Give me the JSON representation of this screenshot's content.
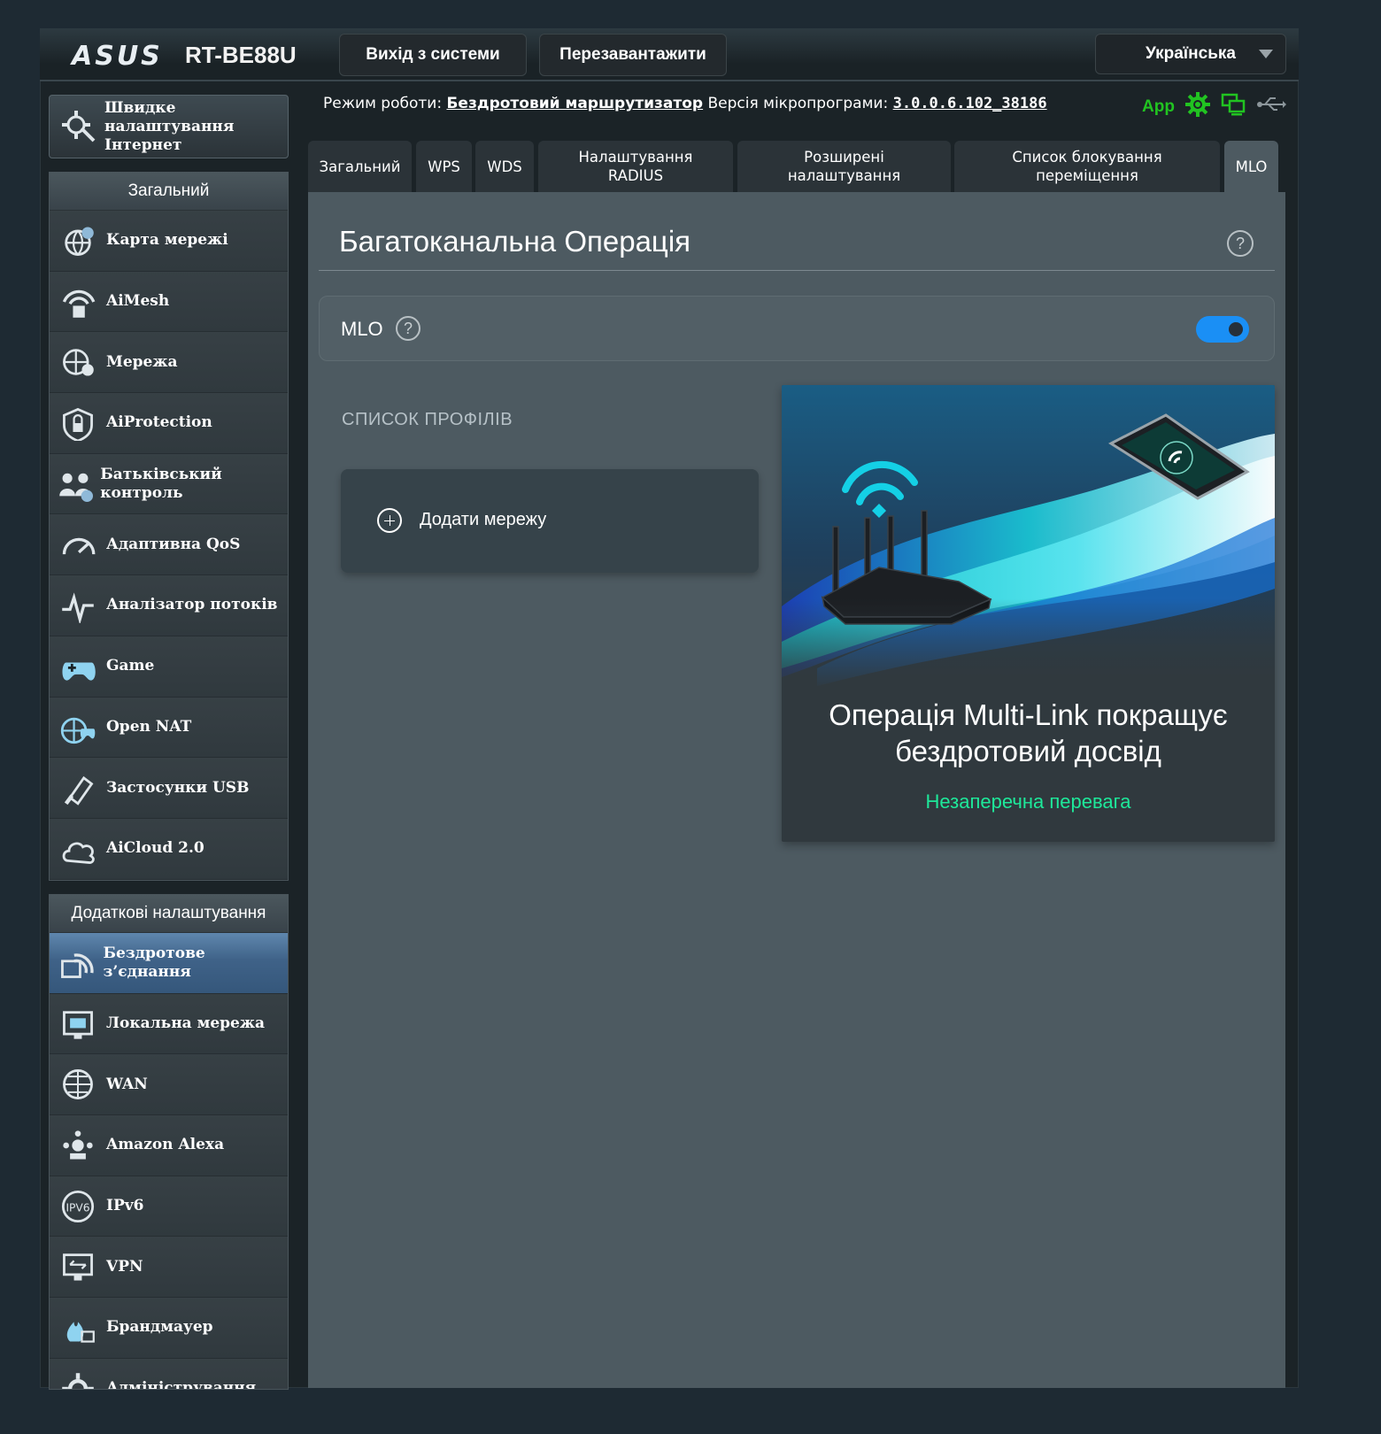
{
  "header": {
    "brand": "ASUS",
    "model": "RT-BE88U",
    "logout_label": "Вихід з системи",
    "reboot_label": "Перезавантажити",
    "language": "Українська"
  },
  "status": {
    "mode_label": "Режим роботи:",
    "mode_value": "Бездротовий маршрутизатор",
    "firmware_label": "Версія мікропрограми:",
    "firmware_value": "3.0.0.6.102_38186",
    "app_label": "App",
    "colors": {
      "app": "#21c321"
    }
  },
  "sidebar": {
    "quick_setup": "Швидке налаштування Інтернет",
    "general_header": "Загальний",
    "general_items": [
      {
        "label": "Карта мережі",
        "icon": "globe-pin-icon"
      },
      {
        "label": "AiMesh",
        "icon": "mesh-icon"
      },
      {
        "label": "Мережа",
        "icon": "network-icon"
      },
      {
        "label": "AiProtection",
        "icon": "shield-lock-icon"
      },
      {
        "label": "Батьківський контроль",
        "icon": "family-icon"
      },
      {
        "label": "Адаптивна QoS",
        "icon": "speedometer-icon"
      },
      {
        "label": "Аналізатор потоків",
        "icon": "pulse-icon"
      },
      {
        "label": "Game",
        "icon": "gamepad-icon"
      },
      {
        "label": "Open NAT",
        "icon": "nat-icon"
      },
      {
        "label": "Застосунки USB",
        "icon": "usb-icon"
      },
      {
        "label": "AiCloud 2.0",
        "icon": "cloud-icon"
      }
    ],
    "advanced_header": "Додаткові налаштування",
    "advanced_items": [
      {
        "label": "Бездротове з’єднання",
        "icon": "wireless-icon",
        "active": true
      },
      {
        "label": "Локальна мережа",
        "icon": "lan-icon"
      },
      {
        "label": "WAN",
        "icon": "wan-globe-icon"
      },
      {
        "label": "Amazon Alexa",
        "icon": "alexa-icon"
      },
      {
        "label": "IPv6",
        "icon": "ipv6-icon"
      },
      {
        "label": "VPN",
        "icon": "vpn-icon"
      },
      {
        "label": "Брандмауер",
        "icon": "firewall-icon"
      },
      {
        "label": "Адміністрування",
        "icon": "gear-icon"
      }
    ]
  },
  "tabs": [
    {
      "label": "Загальний"
    },
    {
      "label": "WPS"
    },
    {
      "label": "WDS"
    },
    {
      "label": "Налаштування RADIUS"
    },
    {
      "label": "Розширені налаштування"
    },
    {
      "label": "Список блокування переміщення"
    },
    {
      "label": "MLO",
      "active": true
    }
  ],
  "main": {
    "title": "Багатоканальна Операція",
    "mlo_label": "MLO",
    "mlo_enabled": true,
    "profiles_title": "СПИСОК ПРОФІЛІВ",
    "add_network": "Додати мережу",
    "promo_title": "Операція Multi-Link покращує бездротовий досвід",
    "promo_subtitle": "Незаперечна перевага",
    "colors": {
      "toggle_on": "#1a8ff5",
      "accent": "#1ee89a"
    }
  }
}
